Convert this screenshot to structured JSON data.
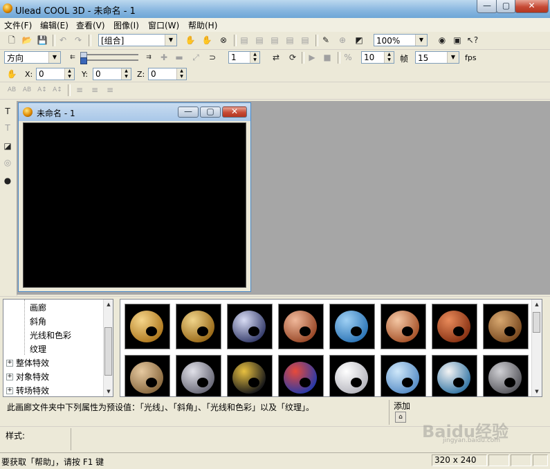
{
  "window": {
    "title": "Ulead COOL 3D - 未命名 - 1",
    "controls": [
      "—",
      "▢",
      "✕"
    ]
  },
  "menu": [
    "文件(F)",
    "编辑(E)",
    "查看(V)",
    "图像(I)",
    "窗口(W)",
    "帮助(H)"
  ],
  "toolbar1": {
    "object_combo": "[组合]",
    "zoom_combo": "100%"
  },
  "toolbar2": {
    "direction_combo": "方向",
    "frame_value": "1",
    "frames_total": "10",
    "frames_label": "帧",
    "fps_value": "15",
    "fps_label": "fps"
  },
  "toolbar3": {
    "x_label": "X:",
    "x_value": "0",
    "y_label": "Y:",
    "y_value": "0",
    "z_label": "Z:",
    "z_value": "0"
  },
  "document": {
    "title": "未命名 - 1",
    "controls": [
      "—",
      "▢",
      "✕"
    ]
  },
  "tree": {
    "items": [
      {
        "label": "画廊",
        "level": 2
      },
      {
        "label": "斜角",
        "level": 2
      },
      {
        "label": "光线和色彩",
        "level": 2
      },
      {
        "label": "纹理",
        "level": 2
      },
      {
        "label": "整体特效",
        "level": 1,
        "expander": "+"
      },
      {
        "label": "对象特效",
        "level": 1,
        "expander": "+"
      },
      {
        "label": "转场特效",
        "level": 1,
        "expander": "+"
      }
    ]
  },
  "gallery": {
    "thumbs": [
      {
        "c1": "#f5d58a",
        "c2": "#b07a20"
      },
      {
        "c1": "#f0d48a",
        "c2": "#9a6b1a"
      },
      {
        "c1": "#d8dcf4",
        "c2": "#39406e"
      },
      {
        "c1": "#f0b89a",
        "c2": "#9a4a2a"
      },
      {
        "c1": "#9fd0f4",
        "c2": "#2f77b8"
      },
      {
        "c1": "#f4c7a4",
        "c2": "#a8552c"
      },
      {
        "c1": "#e88a5a",
        "c2": "#8a3415"
      },
      {
        "c1": "#d8a870",
        "c2": "#7a4a20"
      },
      {
        "c1": "#e6c9a0",
        "c2": "#8a6a40"
      },
      {
        "c1": "#e0e0e8",
        "c2": "#6a6a78"
      },
      {
        "c1": "#e8c040",
        "c2": "#1a1a1a"
      },
      {
        "c1": "#e84a3a",
        "c2": "#2a3aa8"
      },
      {
        "c1": "#ffffff",
        "c2": "#b8b8c0"
      },
      {
        "c1": "#cfe8fa",
        "c2": "#5a8fc8"
      },
      {
        "c1": "#f4f4f4",
        "c2": "#3a7aa8"
      },
      {
        "c1": "#d0d0d4",
        "c2": "#5a5a60"
      }
    ]
  },
  "description": {
    "text": "此画廊文件夹中下列属性为预设值：「光线」、「斜角」、「光线和色彩」以及「纹理」。"
  },
  "add": {
    "label": "添加"
  },
  "style": {
    "label": "样式:"
  },
  "status": {
    "help_text": "要获取「帮助」，请按 F1 键",
    "size": "320 x 240"
  },
  "watermark": {
    "text": "Baidu经验",
    "sub": "jingyan.baidu.com"
  }
}
